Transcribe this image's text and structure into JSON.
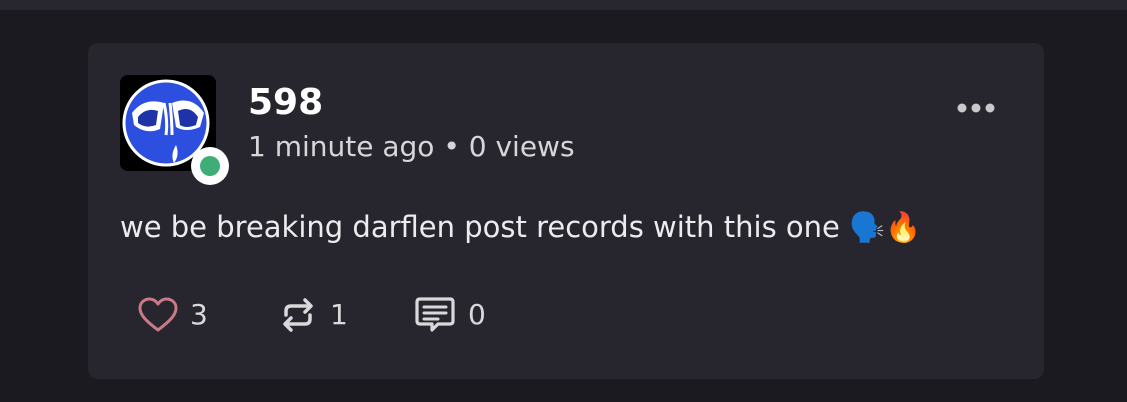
{
  "post": {
    "username": "598",
    "time": "1 minute ago",
    "separator": "•",
    "views": "0 views",
    "text": "we be breaking darflen post records with this one",
    "emojis": "🗣️🔥",
    "likes": "3",
    "reposts": "1",
    "comments": "0"
  },
  "icons": {
    "more": "more-options-icon",
    "like": "heart-icon",
    "repost": "repost-icon",
    "comment": "comment-icon"
  },
  "colors": {
    "background": "#1b1a20",
    "card": "#27262e",
    "status_online": "#3fae76",
    "like_icon": "#c97a86",
    "avatar_blue": "#2d4fe0"
  }
}
